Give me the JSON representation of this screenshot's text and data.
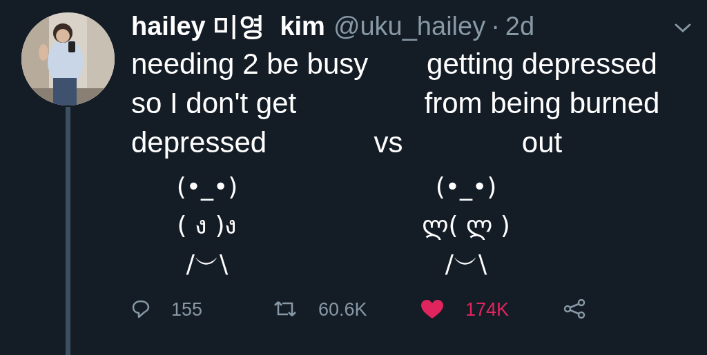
{
  "tweet": {
    "author_name": "hailey 미영  kim",
    "handle": "@uku_hailey",
    "separator": "·",
    "time": "2d",
    "left_text": [
      "needing 2 be busy",
      "so I don't get",
      "depressed"
    ],
    "middle_text": "vs",
    "right_text": [
      "getting depressed",
      "from being burned",
      "out"
    ],
    "left_figure": [
      "(•_•)",
      "( ง )ง",
      "/︶\\"
    ],
    "right_figure": [
      "(•_•)",
      "ლ( ლ )",
      "/︶\\"
    ],
    "actions": [
      {
        "kind": "reply",
        "count": "155",
        "active": false
      },
      {
        "kind": "retweet",
        "count": "60.6K",
        "active": false
      },
      {
        "kind": "like",
        "count": "174K",
        "active": true
      },
      {
        "kind": "share",
        "active": false
      }
    ]
  }
}
